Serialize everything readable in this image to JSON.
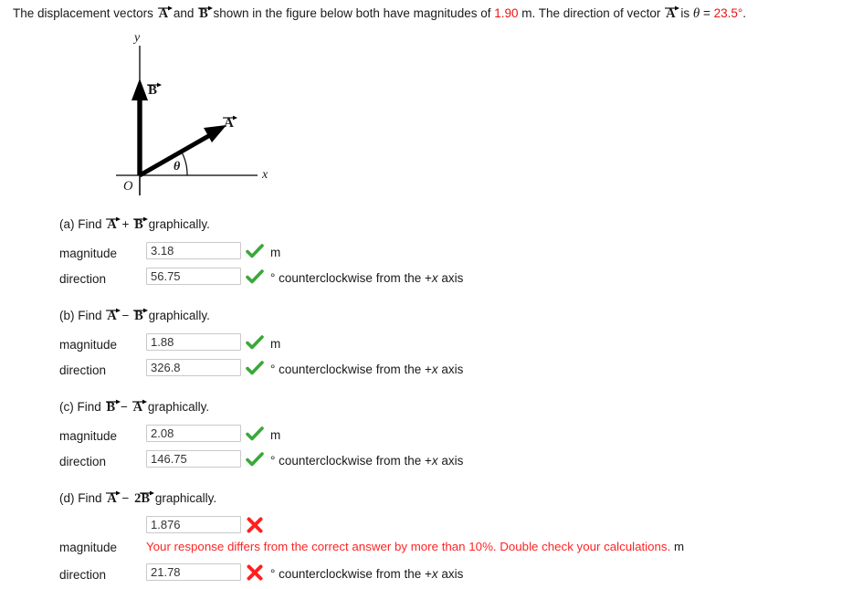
{
  "prompt": {
    "part1": "The displacement vectors ",
    "vec_a": "A",
    "mid1": " and ",
    "vec_b": "B",
    "mid2": " shown in the figure below both have magnitudes of ",
    "magnitude_value": "1.90",
    "mid3": " m. The direction of vector ",
    "vec_a2": "A",
    "mid4": " is ",
    "theta_symbol": "θ",
    "equals": " = ",
    "angle_value": "23.5°",
    "period": "."
  },
  "figure": {
    "y_axis_label": "y",
    "x_axis_label": "x",
    "origin_label": "O",
    "angle_label": "θ",
    "vector_a_label": "A",
    "vector_b_label": "B"
  },
  "colors": {
    "red": "#ee1111",
    "error_red": "#ff2424",
    "check_green": "#3aa83a",
    "x_red": "#ff2020",
    "field_border": "#c9c9c9"
  },
  "parts": [
    {
      "id": "a",
      "label_prefix": "(a) Find ",
      "expr_first": "A",
      "operator": " + ",
      "expr_second": "B",
      "label_suffix": " graphically.",
      "magnitude": {
        "label": "magnitude",
        "value": "3.18",
        "status": "correct",
        "unit": "m"
      },
      "direction": {
        "label": "direction",
        "value": "56.75",
        "status": "correct",
        "unit_prefix": "° counterclockwise from the +",
        "unit_italic": "x",
        "unit_suffix": " axis"
      }
    },
    {
      "id": "b",
      "label_prefix": "(b) Find ",
      "expr_first": "A",
      "operator": " − ",
      "expr_second": "B",
      "label_suffix": " graphically.",
      "magnitude": {
        "label": "magnitude",
        "value": "1.88",
        "status": "correct",
        "unit": "m"
      },
      "direction": {
        "label": "direction",
        "value": "326.8",
        "status": "correct",
        "unit_prefix": "° counterclockwise from the +",
        "unit_italic": "x",
        "unit_suffix": " axis"
      }
    },
    {
      "id": "c",
      "label_prefix": "(c) Find ",
      "expr_first": "B",
      "operator": " − ",
      "expr_second": "A",
      "label_suffix": " graphically.",
      "magnitude": {
        "label": "magnitude",
        "value": "2.08",
        "status": "correct",
        "unit": "m"
      },
      "direction": {
        "label": "direction",
        "value": "146.75",
        "status": "correct",
        "unit_prefix": "° counterclockwise from the +",
        "unit_italic": "x",
        "unit_suffix": " axis"
      }
    },
    {
      "id": "d",
      "label_prefix": "(d) Find ",
      "expr_first": "A",
      "operator": " − ",
      "expr_second": "2B",
      "label_suffix": " graphically.",
      "magnitude": {
        "label": "magnitude",
        "value": "1.876",
        "status": "incorrect",
        "unit": "m",
        "error_message": "Your response differs from the correct answer by more than 10%. Double check your calculations.",
        "error_tail_unit": "m"
      },
      "direction": {
        "label": "direction",
        "value": "21.78",
        "status": "incorrect",
        "unit_prefix": "° counterclockwise from the +",
        "unit_italic": "x",
        "unit_suffix": " axis"
      }
    }
  ]
}
